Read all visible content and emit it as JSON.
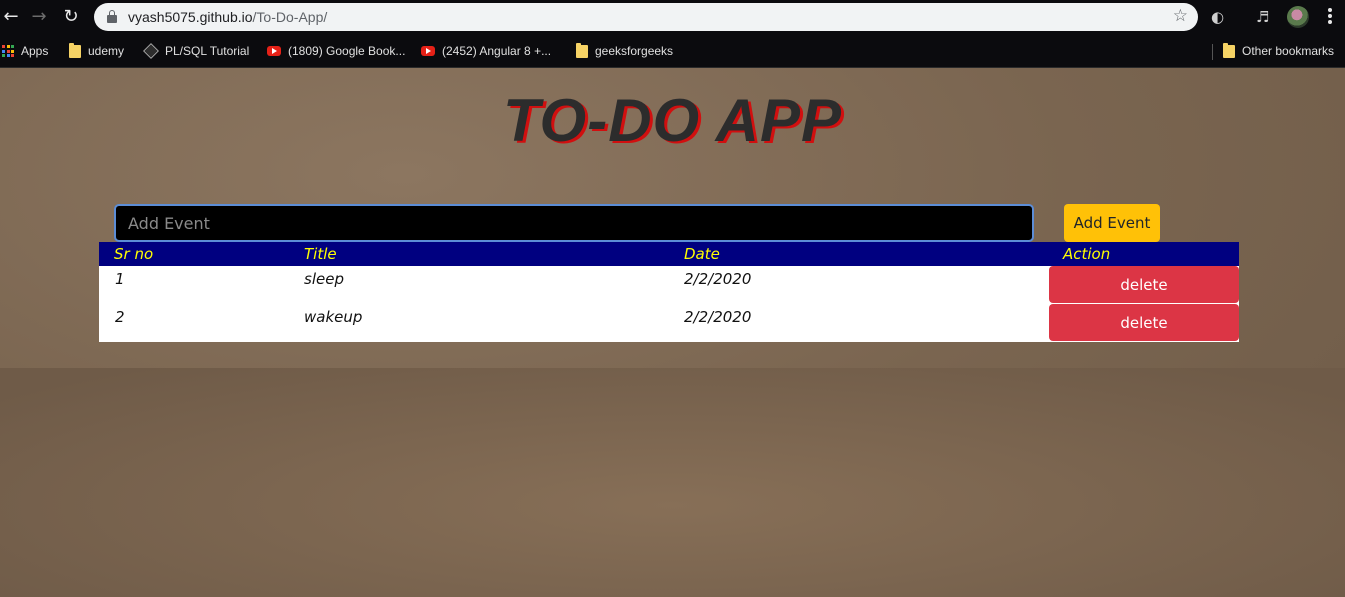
{
  "browser": {
    "url_host": "vyash5075.github.io",
    "url_path": "/To-Do-App/",
    "back_icon": "arrow-left-icon",
    "forward_icon": "arrow-right-icon",
    "reload_icon": "reload-icon",
    "bookmark_star_icon": "star-icon"
  },
  "bookmarks": {
    "apps": "Apps",
    "items": [
      "udemy",
      "PL/SQL Tutorial",
      "(1809) Google Book...",
      "(2452) Angular 8 +...",
      "geeksforgeeks"
    ],
    "other": "Other bookmarks"
  },
  "app": {
    "title": "TO-DO APP",
    "input_placeholder": "Add Event",
    "input_value": "",
    "add_button": "Add Event",
    "colors": {
      "header_bg": "#000080",
      "header_text": "#ffff00",
      "add_button": "#ffc107",
      "delete_button": "#dc3545",
      "title_shadow": "#d10f0f"
    }
  },
  "table": {
    "headers": [
      "Sr no",
      "Title",
      "Date",
      "Action"
    ],
    "rows": [
      {
        "sr": "1",
        "title": "sleep",
        "date": "2/2/2020",
        "action": "delete"
      },
      {
        "sr": "2",
        "title": "wakeup",
        "date": "2/2/2020",
        "action": "delete"
      }
    ]
  }
}
